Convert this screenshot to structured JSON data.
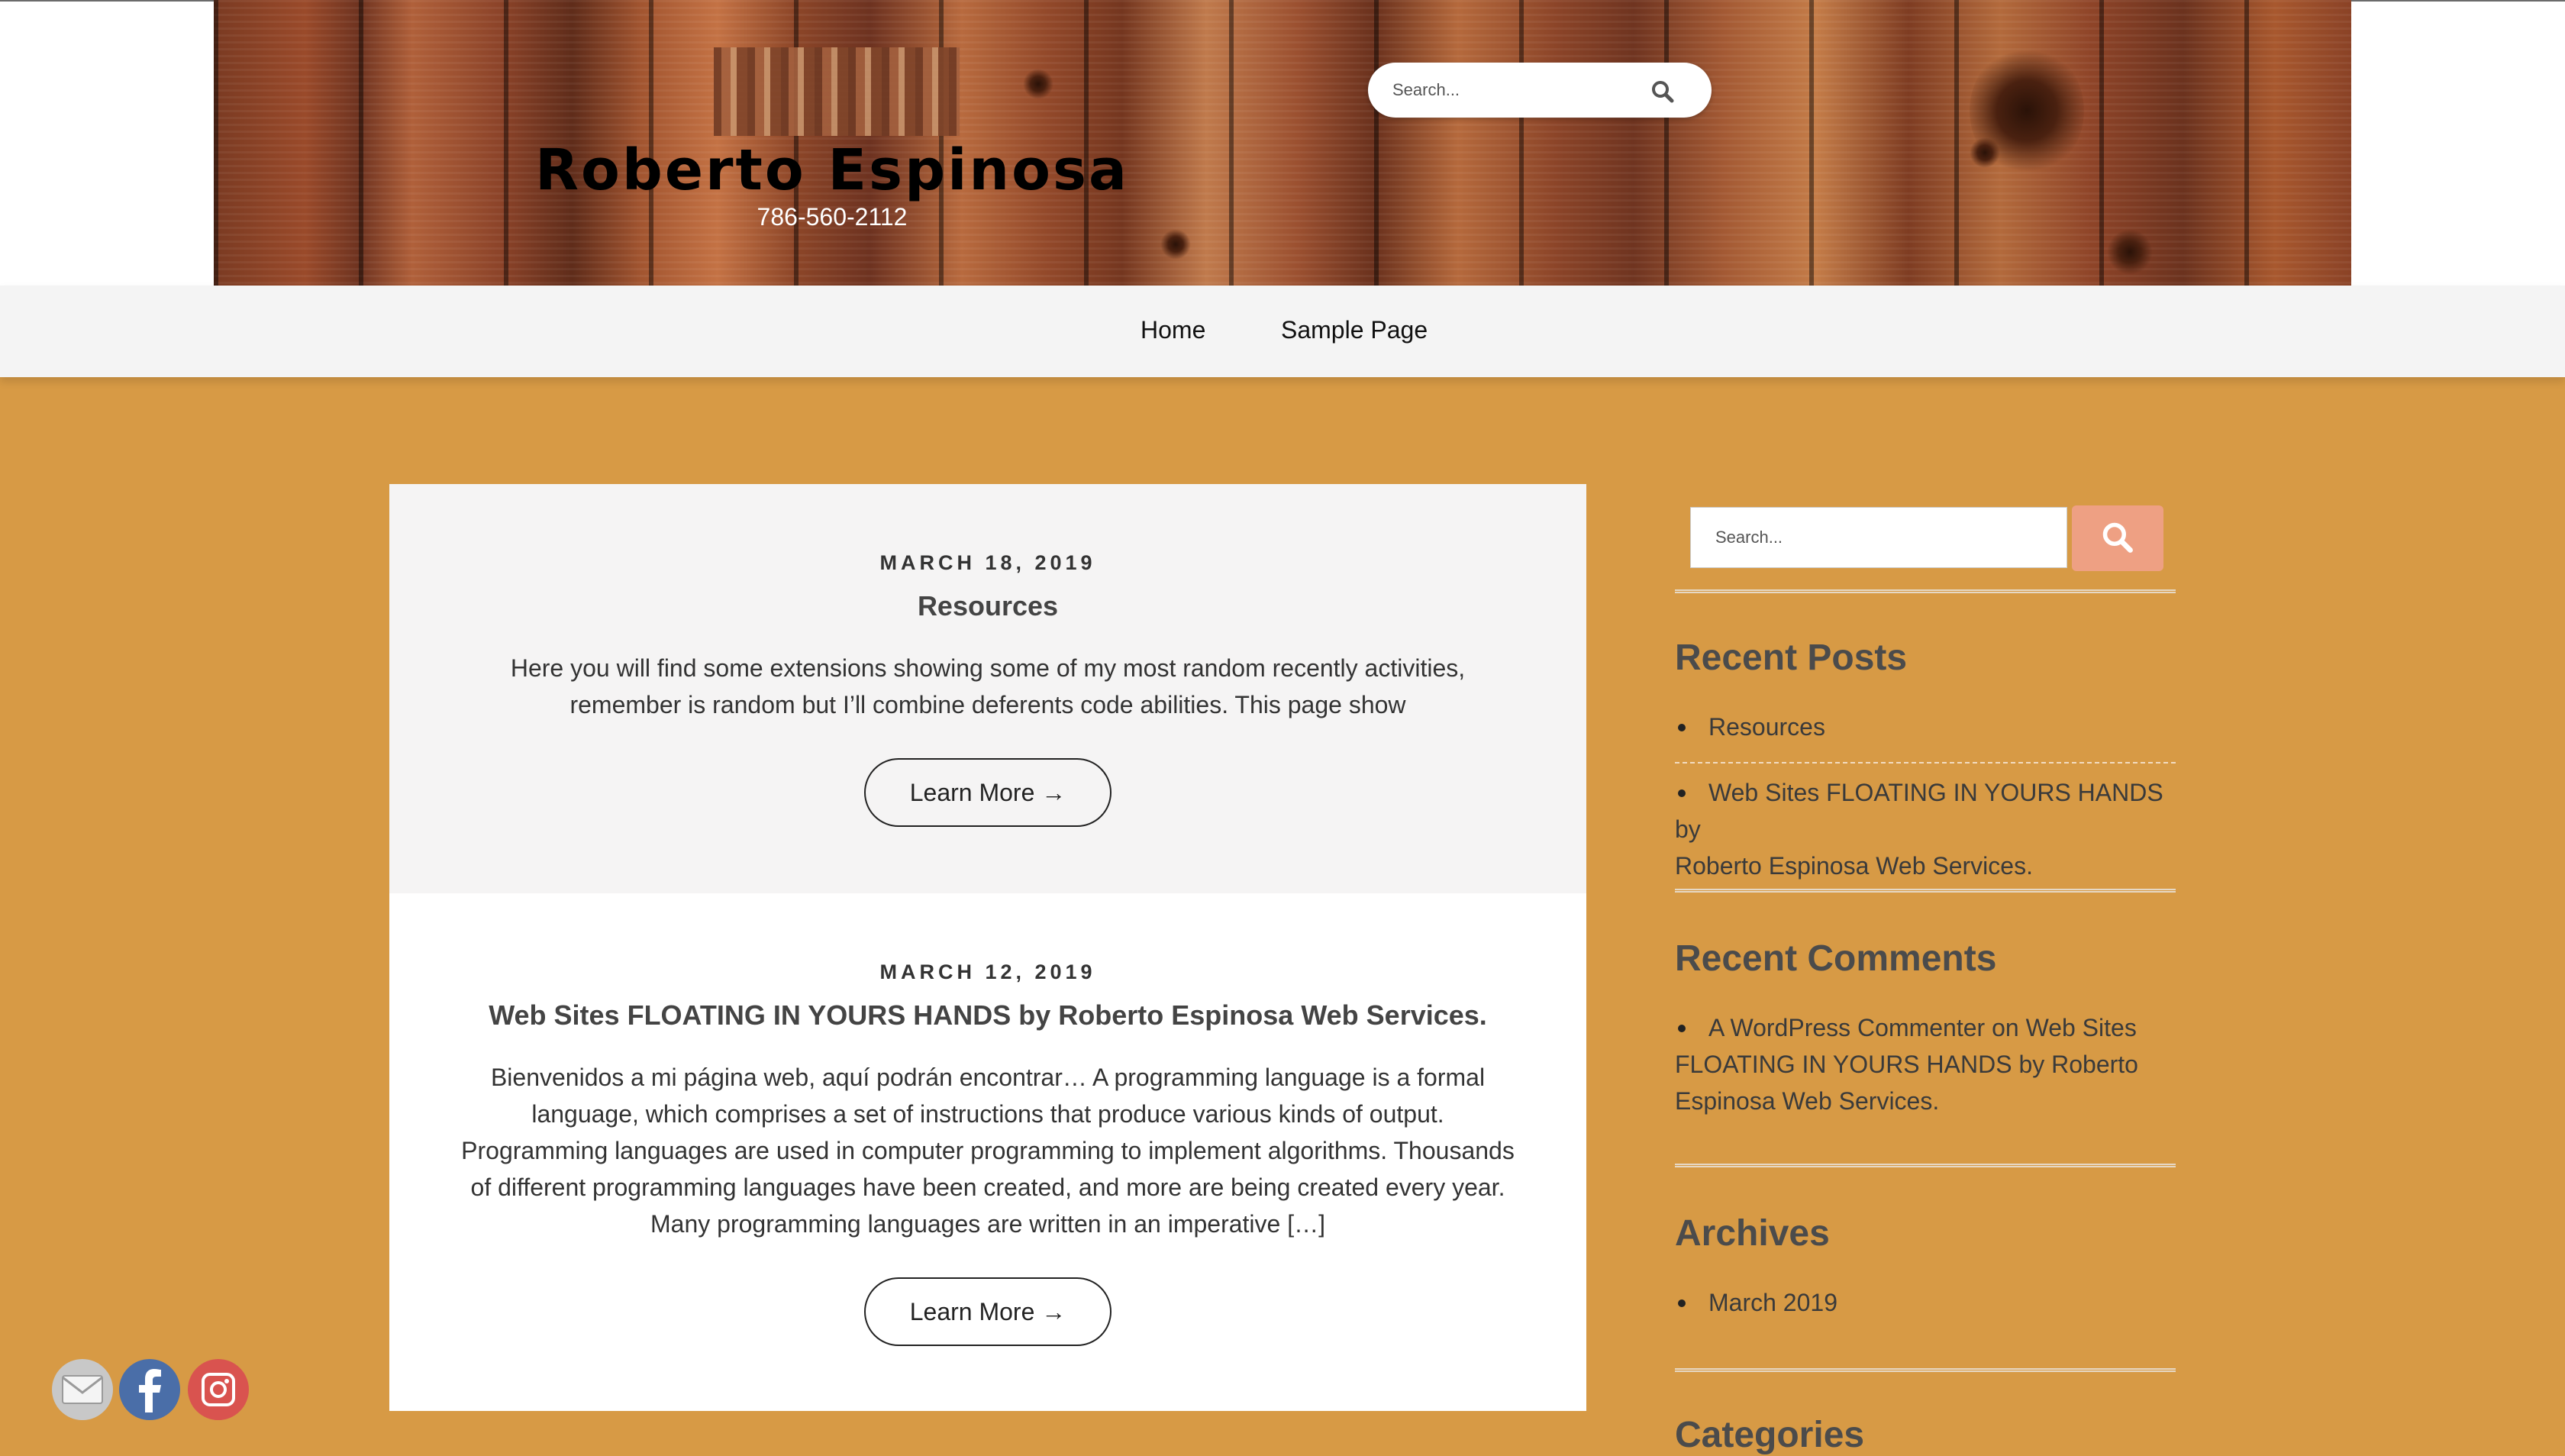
{
  "header": {
    "site_title": "Roberto Espinosa",
    "phone": "786-560-2112",
    "search_placeholder": "Search..."
  },
  "nav": {
    "items": [
      {
        "label": "Home"
      },
      {
        "label": "Sample Page"
      }
    ]
  },
  "posts": [
    {
      "date": "MARCH 18, 2019",
      "title": "Resources",
      "excerpt_lines": [
        "Here you will find some extensions showing some of my most random recently activities,",
        "remember is random but I’ll combine deferents code abilities. This page show"
      ],
      "button": "Learn More →"
    },
    {
      "date": "MARCH 12, 2019",
      "title": "Web Sites FLOATING IN YOURS HANDS by Roberto Espinosa Web Services.",
      "excerpt_lines": [
        "Bienvenidos a mi página web, aquí podrán encontrar… A programming language is a formal",
        "language, which comprises a set of instructions that produce various kinds of output.",
        "Programming languages are used in computer programming to implement algorithms. Thousands",
        "of different programming languages have been created, and more are being created every year.",
        "Many programming languages are written in an imperative […]"
      ],
      "button": "Learn More →"
    }
  ],
  "sidebar": {
    "search_placeholder": "Search...",
    "recent_posts": {
      "title": "Recent Posts",
      "items": [
        "Resources",
        "Web Sites FLOATING IN YOURS HANDS by",
        "Roberto Espinosa Web Services."
      ]
    },
    "recent_comments": {
      "title": "Recent Comments",
      "lines": [
        "A WordPress Commenter on Web Sites",
        "FLOATING IN YOURS HANDS by Roberto",
        "Espinosa Web Services."
      ]
    },
    "archives": {
      "title": "Archives",
      "items": [
        "March 2019"
      ]
    },
    "categories": {
      "title": "Categories"
    }
  },
  "social": {
    "icons": [
      "email-icon",
      "facebook-icon",
      "instagram-icon"
    ]
  },
  "colors": {
    "page_bg": "#d79a45",
    "nav_bg": "#f4f4f4",
    "accent_button": "#eea083"
  }
}
